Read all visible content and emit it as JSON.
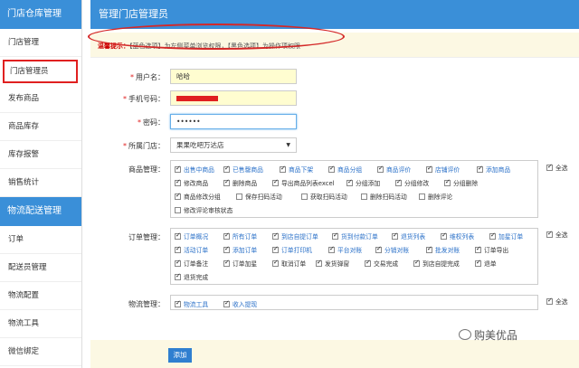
{
  "sidebar": {
    "section1_title": "门店仓库管理",
    "section1_items": [
      "门店管理",
      "门店管理员",
      "发布商品",
      "商品库存",
      "库存报警",
      "销售统计"
    ],
    "section2_title": "物流配送管理",
    "section2_items": [
      "订单",
      "配送员管理",
      "物流配置",
      "物流工具",
      "微信绑定"
    ]
  },
  "main": {
    "title": "管理门店管理员",
    "tip_label": "温馨提示：",
    "tip_text": "【蓝色选项】为左侧菜单浏览权限，【黑色选项】为操作项权限"
  },
  "form": {
    "username_label": "用户名：",
    "username_value": "哈哈",
    "phone_label": "手机号码：",
    "password_label": "密码：",
    "password_value": "••••••",
    "store_label": "所属门店：",
    "store_value": "果果吃吧万达店",
    "goods_label": "商品管理：",
    "orders_label": "订单管理：",
    "logistics_label": "物流管理：",
    "select_all": "全选",
    "add_button": "添加"
  },
  "goods_perms": [
    {
      "label": "出售中商品",
      "blue": true,
      "checked": true
    },
    {
      "label": "已售罄商品",
      "blue": true,
      "checked": true
    },
    {
      "label": "商品下架",
      "blue": true,
      "checked": true
    },
    {
      "label": "商品分组",
      "blue": true,
      "checked": true
    },
    {
      "label": "商品评价",
      "blue": true,
      "checked": true
    },
    {
      "label": "店铺评价",
      "blue": true,
      "checked": true
    },
    {
      "label": "添加商品",
      "blue": true,
      "checked": true
    },
    {
      "label": "修改商品",
      "blue": false,
      "checked": true
    },
    {
      "label": "删除商品",
      "blue": false,
      "checked": true
    },
    {
      "label": "导出商品列表excel",
      "blue": false,
      "checked": true
    },
    {
      "label": "分组添加",
      "blue": false,
      "checked": true
    },
    {
      "label": "分组修改",
      "blue": false,
      "checked": true
    },
    {
      "label": "分组删除",
      "blue": false,
      "checked": true
    },
    {
      "label": "商品修改分组",
      "blue": false,
      "checked": true
    },
    {
      "label": "保存扫码活动",
      "blue": false,
      "checked": false
    },
    {
      "label": "获取扫码活动",
      "blue": false,
      "checked": false
    },
    {
      "label": "删除扫码活动",
      "blue": false,
      "checked": false
    },
    {
      "label": "删除评论",
      "blue": false,
      "checked": false
    },
    {
      "label": "修改评论审核状态",
      "blue": false,
      "checked": false
    }
  ],
  "order_perms": [
    {
      "label": "订单概况",
      "blue": true,
      "checked": true
    },
    {
      "label": "所有订单",
      "blue": true,
      "checked": true
    },
    {
      "label": "到店自提订单",
      "blue": true,
      "checked": true
    },
    {
      "label": "货到付款订单",
      "blue": true,
      "checked": true
    },
    {
      "label": "退货列表",
      "blue": true,
      "checked": true
    },
    {
      "label": "维权列表",
      "blue": true,
      "checked": true
    },
    {
      "label": "加星订单",
      "blue": true,
      "checked": true
    },
    {
      "label": "活动订单",
      "blue": true,
      "checked": true
    },
    {
      "label": "添加订单",
      "blue": true,
      "checked": true
    },
    {
      "label": "订单打印机",
      "blue": true,
      "checked": true
    },
    {
      "label": "平台对账",
      "blue": true,
      "checked": true
    },
    {
      "label": "分销对账",
      "blue": true,
      "checked": true
    },
    {
      "label": "批发对账",
      "blue": true,
      "checked": true
    },
    {
      "label": "订单导出",
      "blue": false,
      "checked": true
    },
    {
      "label": "订单备注",
      "blue": false,
      "checked": true
    },
    {
      "label": "订单加星",
      "blue": false,
      "checked": true
    },
    {
      "label": "取消订单",
      "blue": false,
      "checked": true
    },
    {
      "label": "发货弹窗",
      "blue": false,
      "checked": true
    },
    {
      "label": "交易完成",
      "blue": false,
      "checked": true
    },
    {
      "label": "到店自提完成",
      "blue": false,
      "checked": true
    },
    {
      "label": "退单",
      "blue": false,
      "checked": true
    },
    {
      "label": "退货完成",
      "blue": false,
      "checked": true
    }
  ],
  "logistics_perms": [
    {
      "label": "物流工具",
      "blue": true,
      "checked": true
    },
    {
      "label": "收入提现",
      "blue": true,
      "checked": true
    }
  ],
  "watermark": "购美优品"
}
